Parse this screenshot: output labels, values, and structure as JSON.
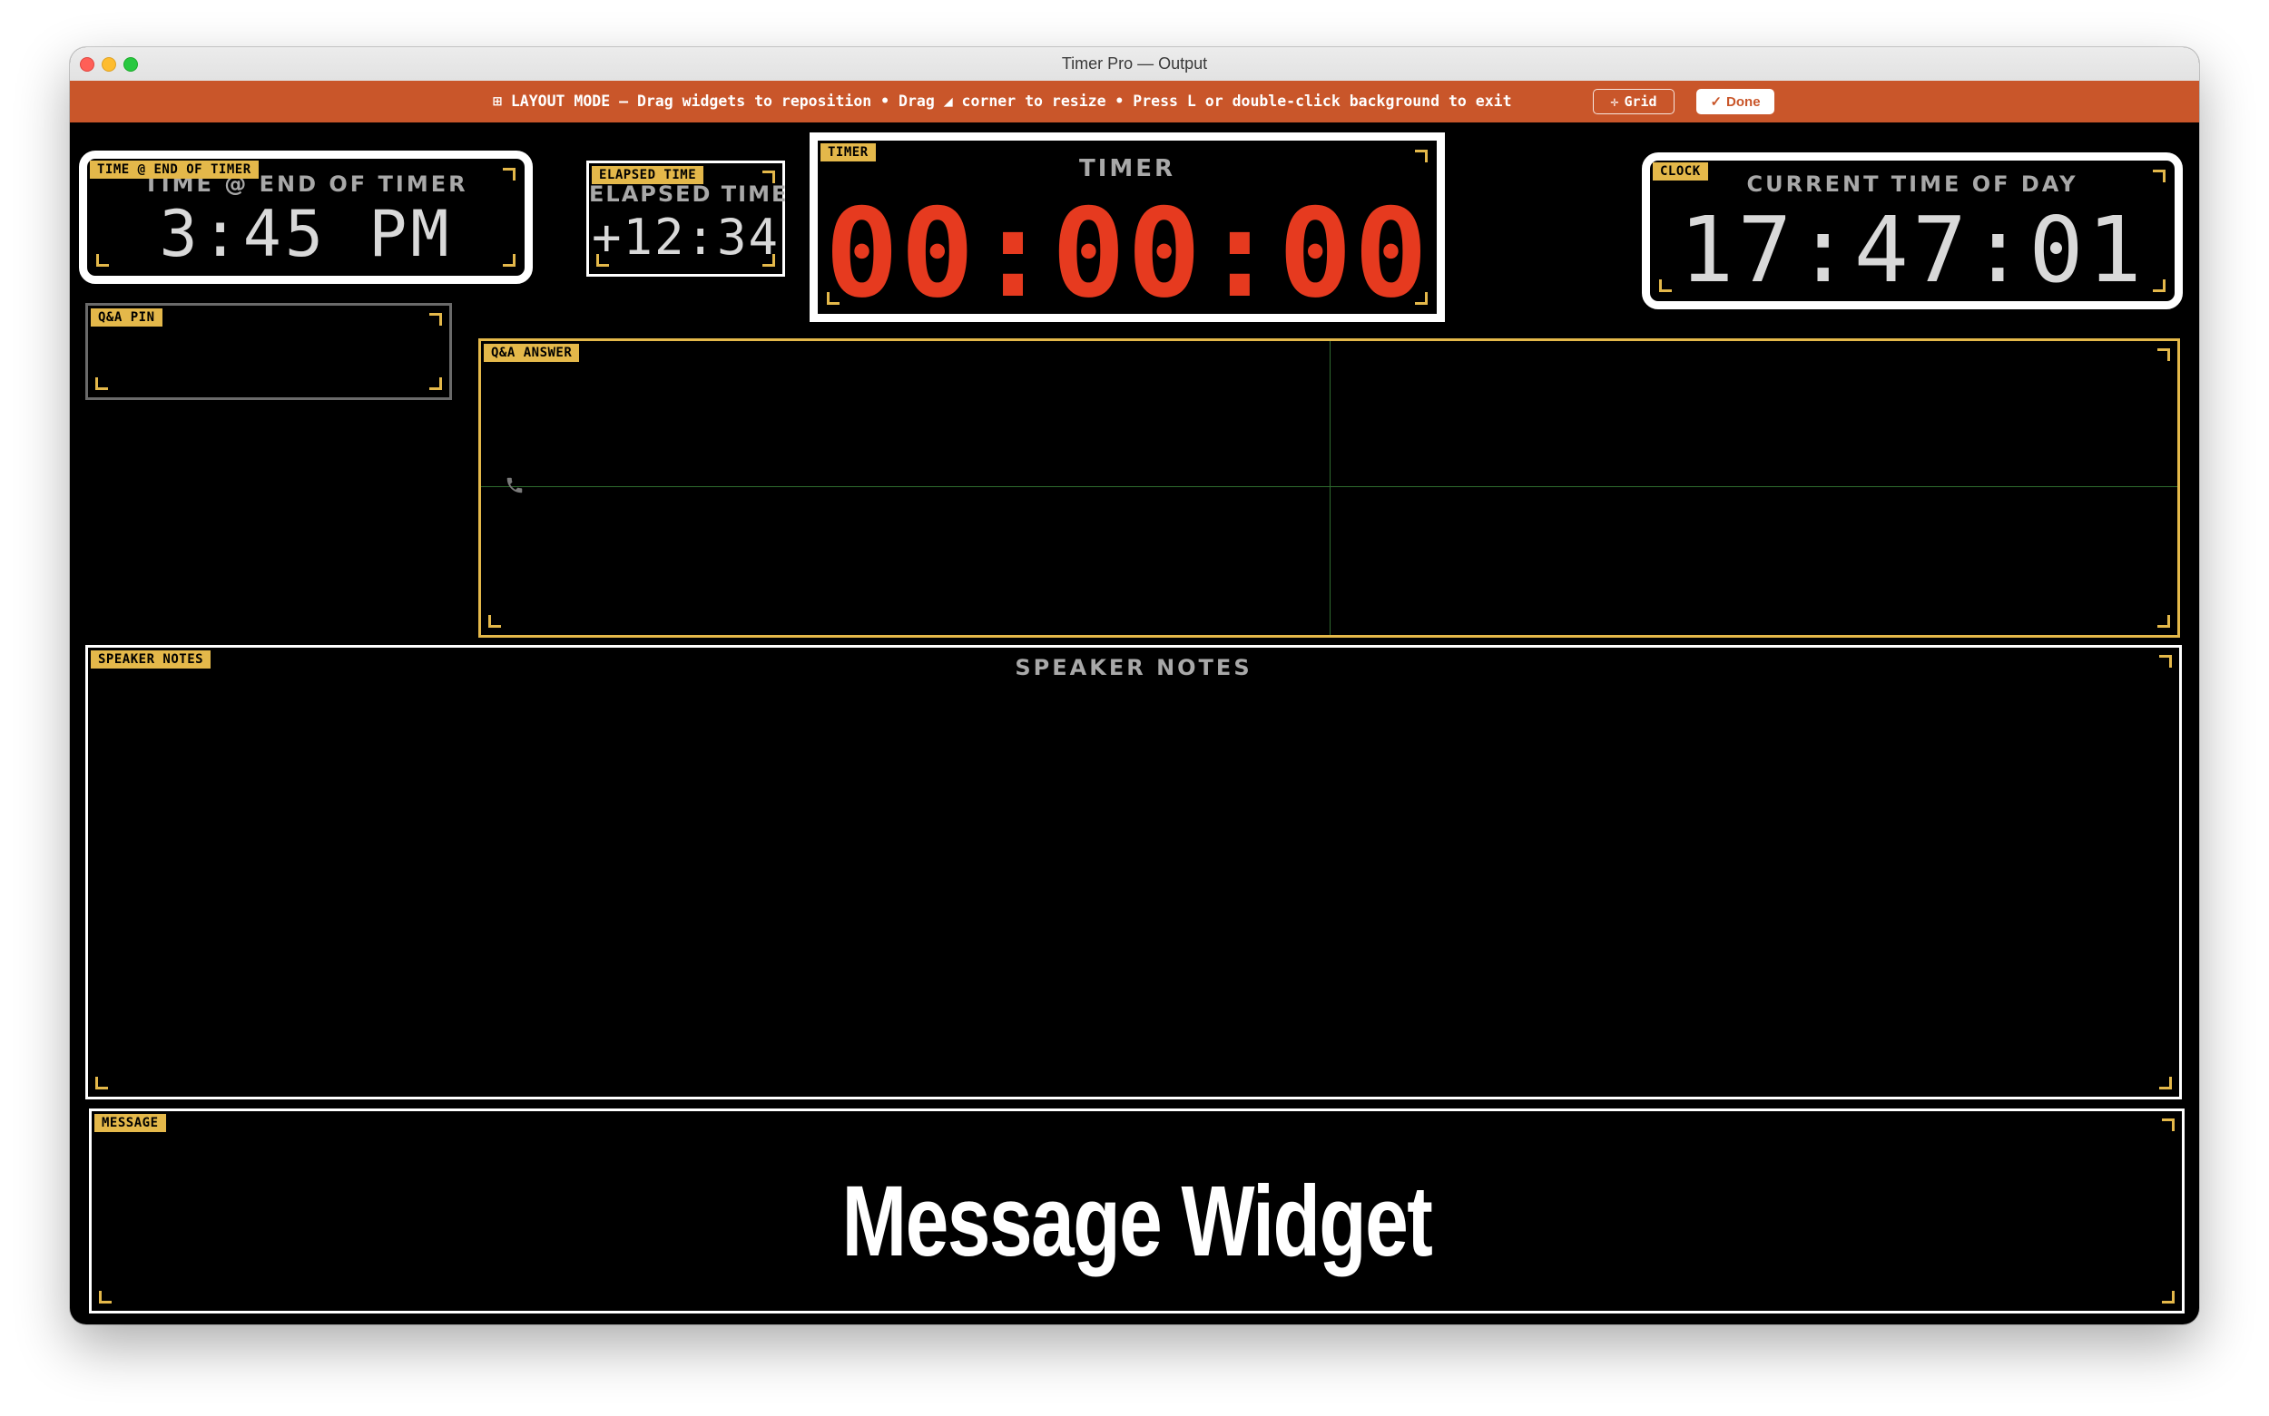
{
  "window": {
    "title": "Timer Pro — Output"
  },
  "layout_bar": {
    "text": "⊞ LAYOUT MODE — Drag widgets to reposition • Drag ◢ corner to resize • Press L or double-click background to exit",
    "grid_icon": "✛",
    "grid_label": "Grid",
    "done_icon": "✓",
    "done_label": "Done"
  },
  "widgets": {
    "end_time": {
      "tag": "TIME @ END OF TIMER",
      "title": "TIME @ END OF TIMER",
      "value": "3:45 PM"
    },
    "elapsed": {
      "tag": "ELAPSED TIME",
      "title": "ELAPSED TIME",
      "value": "+12:34"
    },
    "timer": {
      "tag": "TIMER",
      "title": "TIMER",
      "value": "00:00:00"
    },
    "clock": {
      "tag": "CLOCK",
      "title": "CURRENT TIME OF DAY",
      "value": "17:47:01"
    },
    "qa_pin": {
      "tag": "Q&A PIN"
    },
    "qa_answer": {
      "tag": "Q&A ANSWER",
      "icon": "phone-icon"
    },
    "speaker_notes": {
      "tag": "SPEAKER NOTES",
      "title": "SPEAKER NOTES"
    },
    "message": {
      "tag": "MESSAGE",
      "text": "Message Widget"
    }
  },
  "colors": {
    "layout_bar": "#c9562a",
    "tag": "#e4b84a",
    "timer_digits": "#e63a1f",
    "clock_digits": "#d9d9d9",
    "guide_lines": "#2f6b2f"
  }
}
